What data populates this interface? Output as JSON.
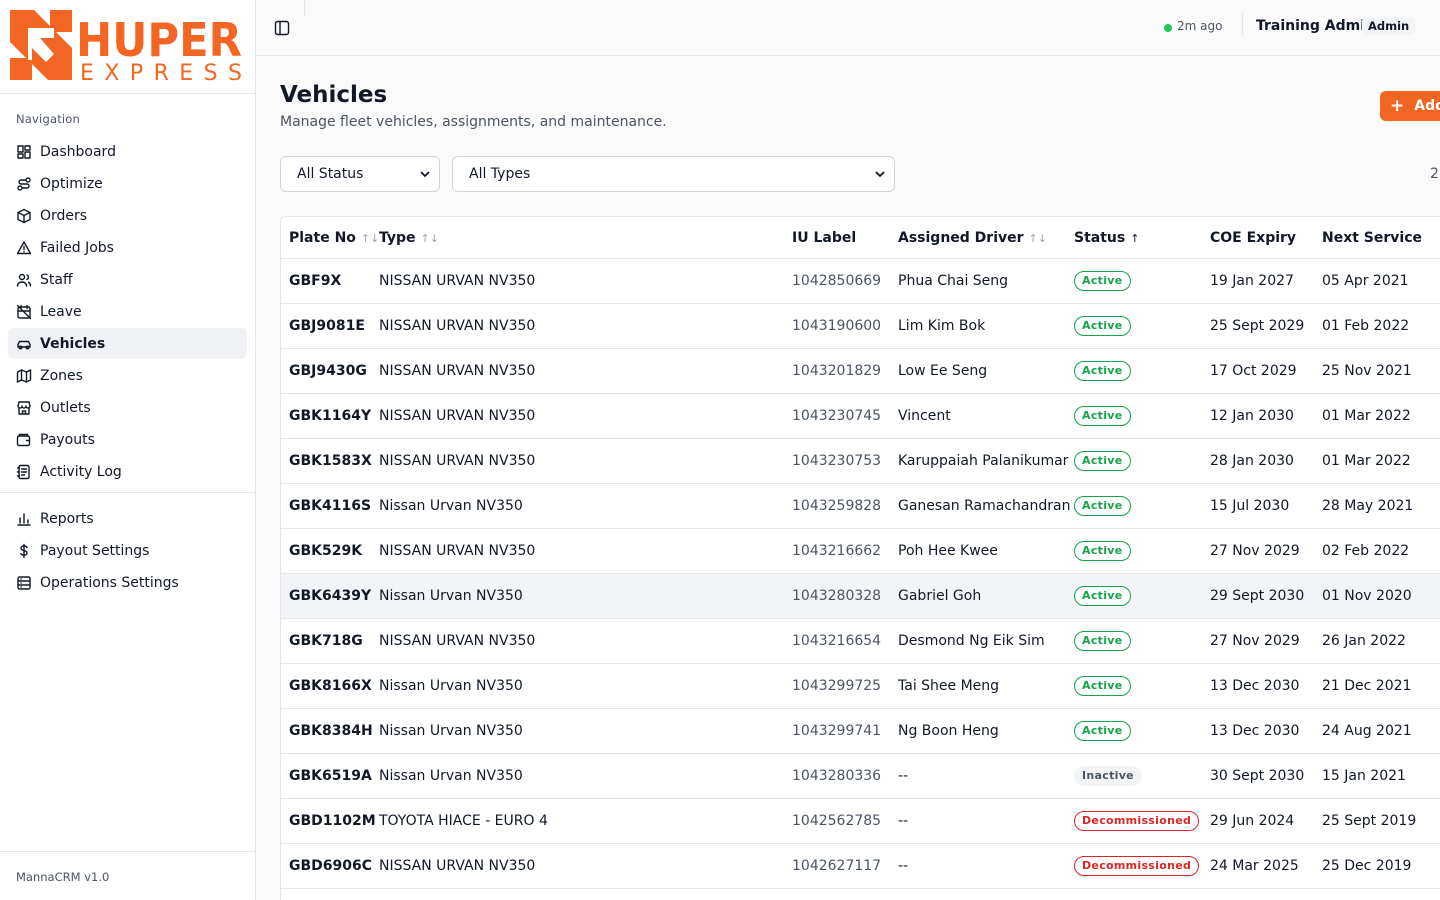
{
  "brand": {
    "logo_top": "HUPER",
    "logo_bottom": "EXPRESS",
    "accent": "#f26522"
  },
  "sidebar": {
    "section_title": "Navigation",
    "items": [
      {
        "label": "Dashboard",
        "icon": "grid-icon"
      },
      {
        "label": "Optimize",
        "icon": "route-icon"
      },
      {
        "label": "Orders",
        "icon": "package-icon"
      },
      {
        "label": "Failed Jobs",
        "icon": "warning-triangle-icon"
      },
      {
        "label": "Staff",
        "icon": "users-icon"
      },
      {
        "label": "Leave",
        "icon": "calendar-off-icon"
      },
      {
        "label": "Vehicles",
        "icon": "car-icon"
      },
      {
        "label": "Zones",
        "icon": "map-icon"
      },
      {
        "label": "Outlets",
        "icon": "store-icon"
      },
      {
        "label": "Payouts",
        "icon": "wallet-icon"
      },
      {
        "label": "Activity Log",
        "icon": "log-icon"
      }
    ],
    "items2": [
      {
        "label": "Reports",
        "icon": "bar-chart-icon"
      },
      {
        "label": "Payout Settings",
        "icon": "dollar-icon"
      },
      {
        "label": "Operations Settings",
        "icon": "database-icon"
      }
    ],
    "footer": "MannaCRM v1.0"
  },
  "header": {
    "sync_text": "2m ago",
    "sync_status_color": "#22c55e",
    "user_name": "Training Admin",
    "role": "Admin"
  },
  "page": {
    "title": "Vehicles",
    "subtitle": "Manage fleet vehicles, assignments, and maintenance.",
    "add_button": "Add",
    "status_filter": "All Status",
    "type_filter": "All Types",
    "count_text": "2"
  },
  "table": {
    "columns": {
      "plate": "Plate No",
      "type": "Type",
      "iu": "IU Label",
      "driver": "Assigned Driver",
      "status": "Status",
      "coe": "COE Expiry",
      "service": "Next Service"
    },
    "rows": [
      {
        "plate": "GBF9X",
        "type": "NISSAN URVAN NV350",
        "iu": "1042850669",
        "driver": "Phua Chai Seng",
        "status": "Active",
        "status_kind": "active",
        "coe": "19 Jan 2027",
        "service": "05 Apr 2021"
      },
      {
        "plate": "GBJ9081E",
        "type": "NISSAN URVAN NV350",
        "iu": "1043190600",
        "driver": "Lim Kim Bok",
        "status": "Active",
        "status_kind": "active",
        "coe": "25 Sept 2029",
        "service": "01 Feb 2022"
      },
      {
        "plate": "GBJ9430G",
        "type": "NISSAN URVAN NV350",
        "iu": "1043201829",
        "driver": "Low Ee Seng",
        "status": "Active",
        "status_kind": "active",
        "coe": "17 Oct 2029",
        "service": "25 Nov 2021"
      },
      {
        "plate": "GBK1164Y",
        "type": "NISSAN URVAN NV350",
        "iu": "1043230745",
        "driver": "Vincent",
        "status": "Active",
        "status_kind": "active",
        "coe": "12 Jan 2030",
        "service": "01 Mar 2022"
      },
      {
        "plate": "GBK1583X",
        "type": "NISSAN URVAN NV350",
        "iu": "1043230753",
        "driver": "Karuppaiah Palanikumar",
        "status": "Active",
        "status_kind": "active",
        "coe": "28 Jan 2030",
        "service": "01 Mar 2022"
      },
      {
        "plate": "GBK4116S",
        "type": "Nissan Urvan NV350",
        "iu": "1043259828",
        "driver": "Ganesan Ramachandran",
        "status": "Active",
        "status_kind": "active",
        "coe": "15 Jul 2030",
        "service": "28 May 2021"
      },
      {
        "plate": "GBK529K",
        "type": "NISSAN URVAN NV350",
        "iu": "1043216662",
        "driver": "Poh Hee Kwee",
        "status": "Active",
        "status_kind": "active",
        "coe": "27 Nov 2029",
        "service": "02 Feb 2022"
      },
      {
        "plate": "GBK6439Y",
        "type": "Nissan Urvan NV350",
        "iu": "1043280328",
        "driver": "Gabriel Goh",
        "status": "Active",
        "status_kind": "active",
        "coe": "29 Sept 2030",
        "service": "01 Nov 2020",
        "highlight": true
      },
      {
        "plate": "GBK718G",
        "type": "NISSAN URVAN NV350",
        "iu": "1043216654",
        "driver": "Desmond Ng Eik Sim",
        "status": "Active",
        "status_kind": "active",
        "coe": "27 Nov 2029",
        "service": "26 Jan 2022"
      },
      {
        "plate": "GBK8166X",
        "type": "Nissan Urvan NV350",
        "iu": "1043299725",
        "driver": "Tai Shee Meng",
        "status": "Active",
        "status_kind": "active",
        "coe": "13 Dec 2030",
        "service": "21 Dec 2021"
      },
      {
        "plate": "GBK8384H",
        "type": "Nissan Urvan NV350",
        "iu": "1043299741",
        "driver": "Ng Boon Heng",
        "status": "Active",
        "status_kind": "active",
        "coe": "13 Dec 2030",
        "service": "24 Aug 2021"
      },
      {
        "plate": "GBK6519A",
        "type": "Nissan Urvan NV350",
        "iu": "1043280336",
        "driver": "--",
        "status": "Inactive",
        "status_kind": "inactive",
        "coe": "30 Sept 2030",
        "service": "15 Jan 2021"
      },
      {
        "plate": "GBD1102M",
        "type": "TOYOTA HIACE - EURO 4",
        "iu": "1042562785",
        "driver": "--",
        "status": "Decommissioned",
        "status_kind": "decom",
        "coe": "29 Jun 2024",
        "service": "25 Sept 2019"
      },
      {
        "plate": "GBD6906C",
        "type": "NISSAN URVAN NV350",
        "iu": "1042627117",
        "driver": "--",
        "status": "Decommissioned",
        "status_kind": "decom",
        "coe": "24 Mar 2025",
        "service": "25 Dec 2019"
      }
    ]
  }
}
